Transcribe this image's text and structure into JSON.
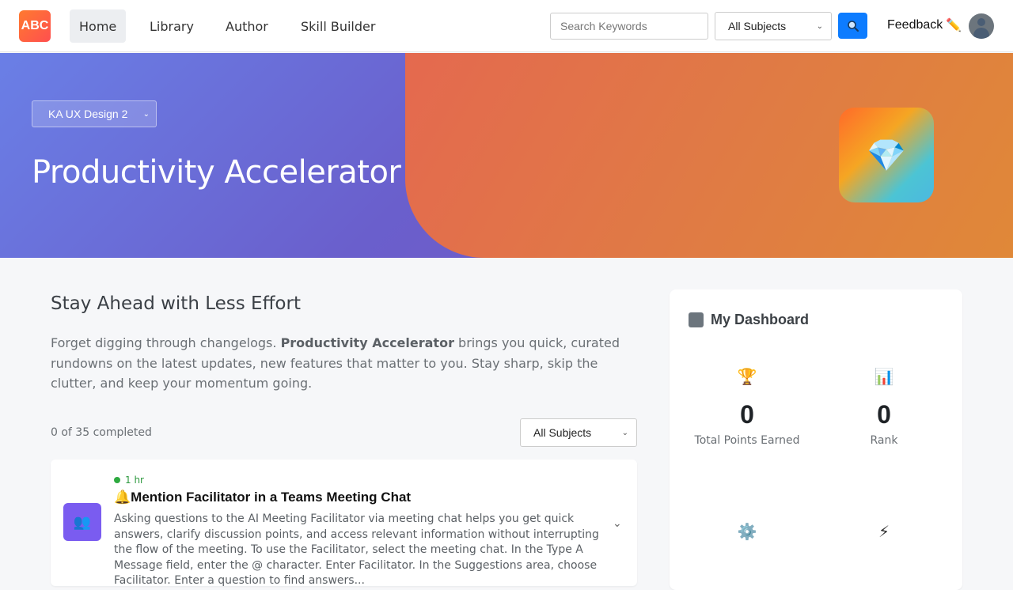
{
  "topbar": {
    "logo_text": "ABC",
    "nav": [
      {
        "label": "Home",
        "active": true
      },
      {
        "label": "Library"
      },
      {
        "label": "Author"
      },
      {
        "label": "Skill Builder"
      }
    ],
    "search_placeholder": "Search Keywords",
    "subject_filter": "All Subjects",
    "feedback_label": "Feedback",
    "feedback_icon": "✏️"
  },
  "hero": {
    "program_select": "KA UX Design 2",
    "title": "Productivity Accelerator",
    "badge_icon": "💎",
    "colors": {
      "left": "#6a7fe6",
      "right": "#e07a45"
    }
  },
  "intro": {
    "heading": "Stay Ahead with Less Effort",
    "text_before": "Forget digging through changelogs. ",
    "text_bold": "Productivity Accelerator",
    "text_after": " brings you quick, curated rundowns on the latest updates, new features that matter to you. Stay sharp, skip the clutter, and keep your momentum going."
  },
  "progress": {
    "text": "0 of 35 completed",
    "filter": "All Subjects"
  },
  "cards": [
    {
      "duration": "1 hr",
      "title_icon": "🔔",
      "title": "Mention Facilitator in a Teams Meeting Chat",
      "description": "Asking questions to the AI Meeting Facilitator via meeting chat helps you get quick answers, clarify discussion points, and access relevant information without interrupting the flow of the meeting. To use the Facilitator, select the meeting chat. In the Type A Message field, enter the @ character. Enter Facilitator. In the Suggestions area, choose Facilitator. Enter a question to find answers...",
      "icon": "👥"
    }
  ],
  "dashboard": {
    "title": "My Dashboard",
    "stats": [
      {
        "icon": "🏆",
        "value": "0",
        "label": "Total Points Earned"
      },
      {
        "icon": "📊",
        "value": "0",
        "label": "Rank"
      },
      {
        "icon": "⚙️",
        "value": "",
        "label": ""
      },
      {
        "icon": "⚡",
        "value": "",
        "label": ""
      }
    ]
  }
}
